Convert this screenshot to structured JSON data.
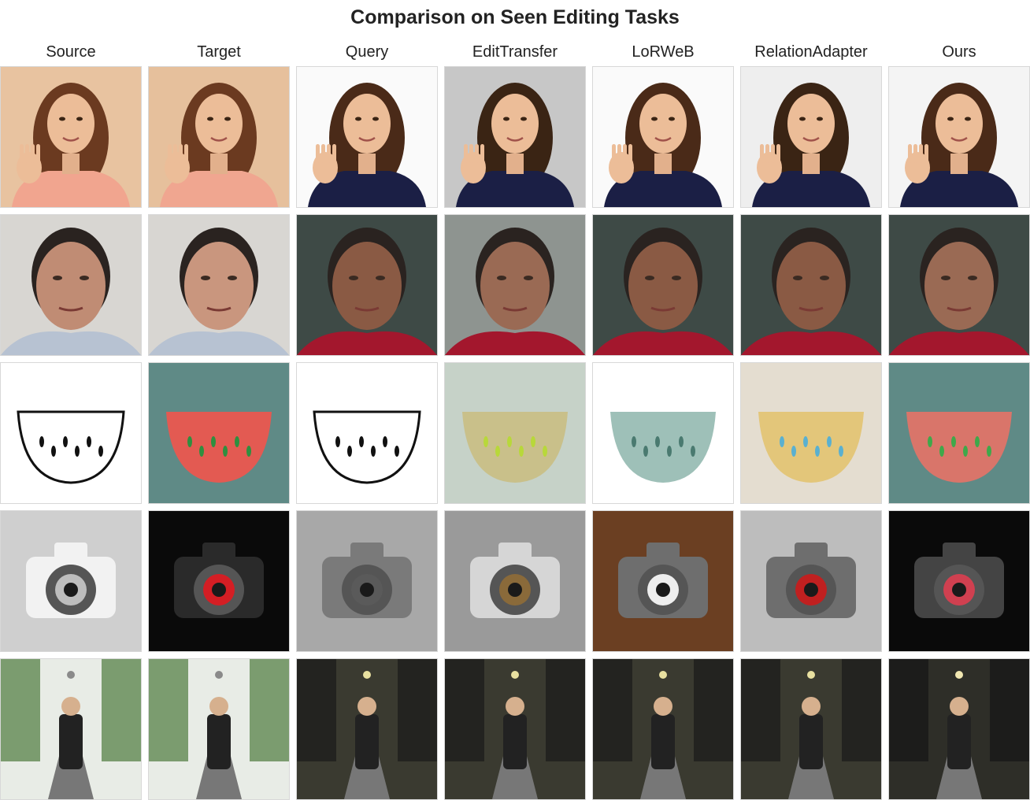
{
  "title": "Comparison on Seen Editing Tasks",
  "columns": [
    "Source",
    "Target",
    "Query",
    "EditTransfer",
    "LoRWeB",
    "RelationAdapter",
    "Ours"
  ],
  "rows": [
    {
      "cells": [
        {
          "bg": "#e8c3a0",
          "fg": "#f1a58f",
          "accent": "#6b3a20"
        },
        {
          "bg": "#e6c09c",
          "fg": "#f0a690",
          "accent": "#6b3a20"
        },
        {
          "bg": "#fafafa",
          "fg": "#1b1f45",
          "accent": "#4a2a18"
        },
        {
          "bg": "#c7c7c7",
          "fg": "#1b1f45",
          "accent": "#3a2414"
        },
        {
          "bg": "#fafafa",
          "fg": "#1b1f45",
          "accent": "#4a2a18"
        },
        {
          "bg": "#eeeeee",
          "fg": "#1b1f45",
          "accent": "#3a2414"
        },
        {
          "bg": "#f4f4f4",
          "fg": "#1b1f45",
          "accent": "#4a2a18"
        }
      ]
    },
    {
      "cells": [
        {
          "bg": "#d8d6d2",
          "fg": "#b7c2d2",
          "accent": "#c08c74"
        },
        {
          "bg": "#d8d6d2",
          "fg": "#b7c2d2",
          "accent": "#c9967e"
        },
        {
          "bg": "#3e4a46",
          "fg": "#a3172d",
          "accent": "#8a5a44"
        },
        {
          "bg": "#8e9490",
          "fg": "#a3172d",
          "accent": "#9a6a54"
        },
        {
          "bg": "#3e4a46",
          "fg": "#a3172d",
          "accent": "#8a5a44"
        },
        {
          "bg": "#3e4a46",
          "fg": "#a3172d",
          "accent": "#8a5a44"
        },
        {
          "bg": "#3e4a46",
          "fg": "#a3172d",
          "accent": "#9a6a54"
        }
      ]
    },
    {
      "cells": [
        {
          "bg": "#ffffff",
          "fg": "#111111",
          "accent": "#ffffff"
        },
        {
          "bg": "#5f8a86",
          "fg": "#e35a52",
          "accent": "#2f8f3f"
        },
        {
          "bg": "#ffffff",
          "fg": "#111111",
          "accent": "#ffffff"
        },
        {
          "bg": "#c6d2c8",
          "fg": "#c9c08a",
          "accent": "#b8d83a"
        },
        {
          "bg": "#ffffff",
          "fg": "#9ec0b8",
          "accent": "#4a7a70"
        },
        {
          "bg": "#e4ddd0",
          "fg": "#e3c67a",
          "accent": "#5ab0d0"
        },
        {
          "bg": "#5f8a86",
          "fg": "#d9756a",
          "accent": "#3fa84a"
        }
      ]
    },
    {
      "cells": [
        {
          "bg": "#cfcfcf",
          "fg": "#f2f2f2",
          "accent": "#bdbdbd"
        },
        {
          "bg": "#0a0a0a",
          "fg": "#2a2a2a",
          "accent": "#d41e24"
        },
        {
          "bg": "#a8a8a8",
          "fg": "#7a7a7a",
          "accent": "#5a5a5a"
        },
        {
          "bg": "#9a9a9a",
          "fg": "#d6d6d6",
          "accent": "#8a6a3a"
        },
        {
          "bg": "#6b3f22",
          "fg": "#6e6e6e",
          "accent": "#eeeeee"
        },
        {
          "bg": "#bdbdbd",
          "fg": "#6e6e6e",
          "accent": "#c02020"
        },
        {
          "bg": "#0a0a0a",
          "fg": "#444444",
          "accent": "#d04050"
        }
      ]
    },
    {
      "cells": [
        {
          "bg": "#e8ece6",
          "fg": "#4d7a3c",
          "accent": "#8a8a8a"
        },
        {
          "bg": "#e8ece6",
          "fg": "#4d7a3c",
          "accent": "#8a8a8a"
        },
        {
          "bg": "#3a3a30",
          "fg": "#1a1a1a",
          "accent": "#e8e0a0"
        },
        {
          "bg": "#3a3a30",
          "fg": "#1a1a1a",
          "accent": "#e8e0a0"
        },
        {
          "bg": "#3a3a30",
          "fg": "#1a1a1a",
          "accent": "#e8e0a0"
        },
        {
          "bg": "#3a3a30",
          "fg": "#1a1a1a",
          "accent": "#e8e0a0"
        },
        {
          "bg": "#2e2e28",
          "fg": "#151515",
          "accent": "#f0e6b0"
        }
      ]
    }
  ],
  "row_subjects": [
    "portrait-hand-gesture",
    "portrait-face",
    "sketch-fruit",
    "product-object",
    "street-scene"
  ]
}
